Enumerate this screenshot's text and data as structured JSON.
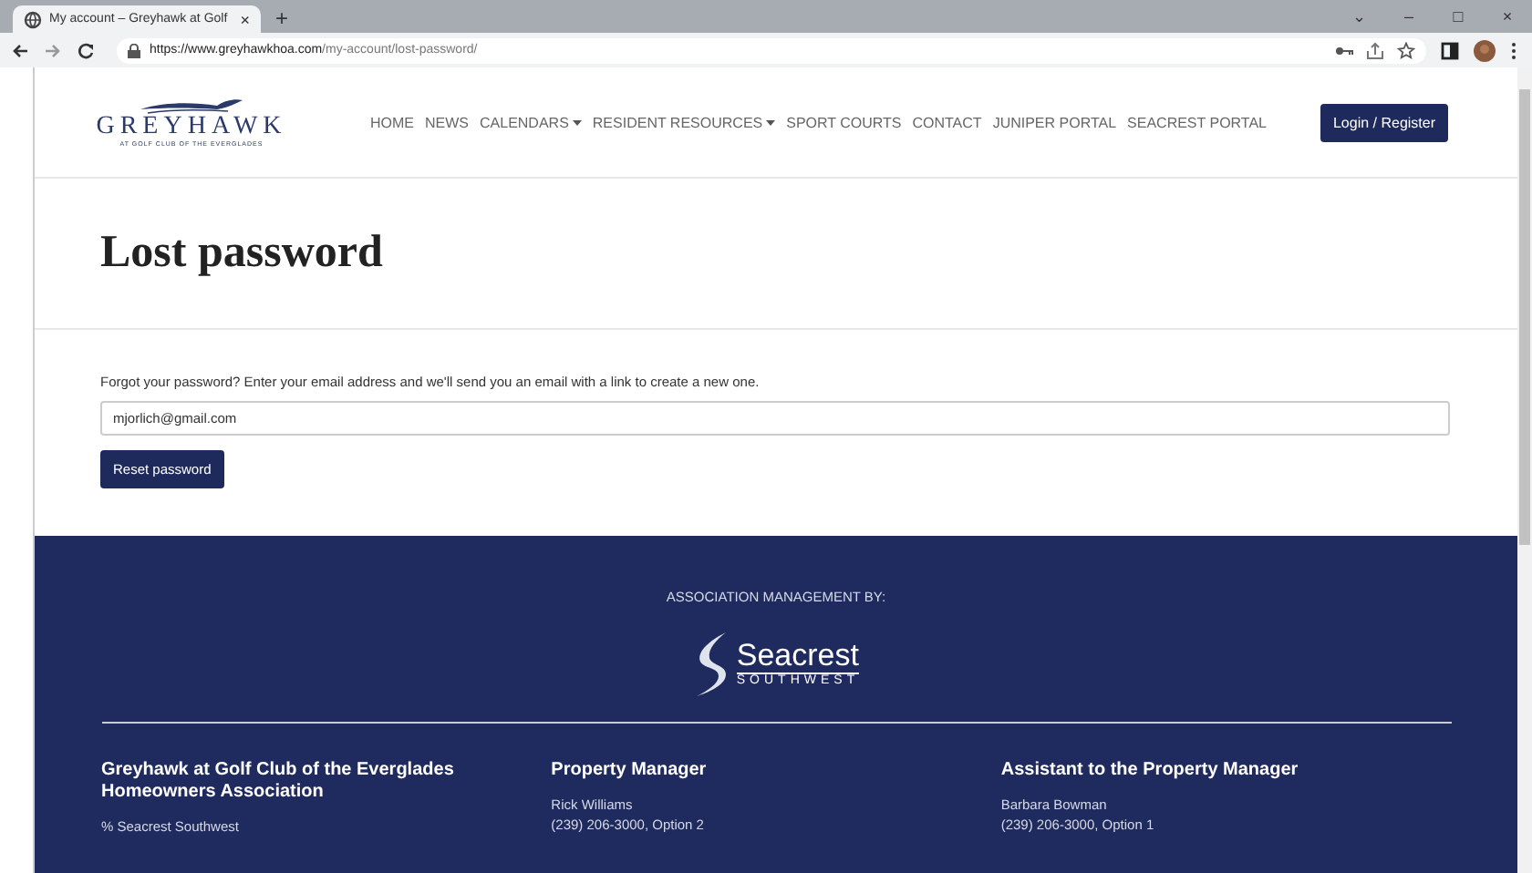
{
  "browser": {
    "tab_title": "My account – Greyhawk at Golf",
    "tab_close": "×",
    "new_tab": "+",
    "url_host": "https://www.greyhawkhoa.com",
    "url_path": "/my-account/lost-password/",
    "window_controls": [
      "⌄",
      "–",
      "□",
      "×"
    ]
  },
  "site": {
    "logo": {
      "name": "GREYHAWK",
      "tagline": "AT GOLF CLUB OF THE EVERGLADES"
    },
    "nav": [
      {
        "label": "HOME",
        "dropdown": false
      },
      {
        "label": "NEWS",
        "dropdown": false
      },
      {
        "label": "CALENDARS",
        "dropdown": true
      },
      {
        "label": "RESIDENT RESOURCES",
        "dropdown": true
      },
      {
        "label": "SPORT COURTS",
        "dropdown": false
      },
      {
        "label": "CONTACT",
        "dropdown": false
      },
      {
        "label": "JUNIPER PORTAL",
        "dropdown": false
      },
      {
        "label": "SEACREST PORTAL",
        "dropdown": false
      }
    ],
    "login_button": "Login / Register"
  },
  "page": {
    "title": "Lost password",
    "instructions": "Forgot your password? Enter your email address and we'll send you an email with a link to create a new one.",
    "email_value": "mjorlich@gmail.com",
    "submit_button": "Reset password"
  },
  "footer": {
    "management_label": "ASSOCIATION MANAGEMENT BY:",
    "management_logo": {
      "name": "Seacrest",
      "sub": "SOUTHWEST"
    },
    "columns": [
      {
        "heading": "Greyhawk at Golf Club of the Everglades Homeowners Association",
        "lines": [
          "% Seacrest Southwest"
        ]
      },
      {
        "heading": "Property Manager",
        "lines": [
          "Rick Williams",
          "(239) 206-3000, Option 2"
        ]
      },
      {
        "heading": "Assistant to the Property Manager",
        "lines": [
          "Barbara Bowman",
          "(239) 206-3000, Option 1"
        ]
      }
    ]
  }
}
